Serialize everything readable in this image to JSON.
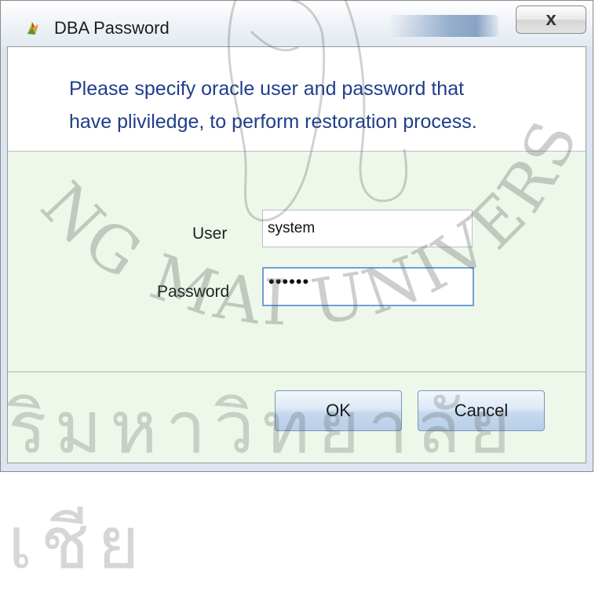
{
  "window": {
    "title": "DBA Password",
    "close_symbol": "x"
  },
  "header": {
    "instructions_line1": "Please specify oracle user and password that",
    "instructions_line2": "have pliviledge, to perform restoration process."
  },
  "form": {
    "user_label": "User",
    "user_value": "system",
    "password_label": "Password",
    "password_value": "••••••"
  },
  "buttons": {
    "ok_label": "OK",
    "cancel_label": "Cancel"
  },
  "icons": {
    "app": "app-icon",
    "close": "close-icon"
  },
  "watermark": {
    "arc_text": "NG MAI UNIVERSITY",
    "bottom_text": "ริมหาวิทยาลัยเชีย"
  },
  "colors": {
    "instruction_text": "#1f3d8a",
    "form_background": "#eef8ea",
    "button_gradient_bottom": "#b8cfe8",
    "focused_field_border": "#6fa0d8"
  }
}
